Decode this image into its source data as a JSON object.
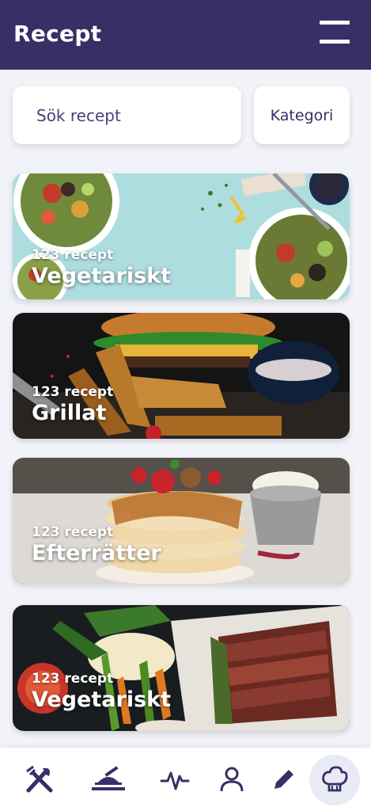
{
  "header": {
    "title": "Recept"
  },
  "search": {
    "placeholder": "Sök recept"
  },
  "category_button": {
    "label": "Kategori"
  },
  "categories": [
    {
      "count": "123 recept",
      "name": "Vegetariskt"
    },
    {
      "count": "123 recept",
      "name": "Grillat"
    },
    {
      "count": "123 recept",
      "name": "Efterrätter"
    },
    {
      "count": "123 recept",
      "name": "Vegetariskt"
    }
  ],
  "nav": {
    "items": [
      "utensils-icon",
      "meal-icon",
      "activity-icon",
      "profile-icon",
      "pencil-icon",
      "chef-hat-icon"
    ],
    "active": "chef-hat-icon"
  },
  "colors": {
    "primary": "#3a2e66",
    "background": "#f2f3f8",
    "nav_active_bg": "#e9ebf4"
  }
}
